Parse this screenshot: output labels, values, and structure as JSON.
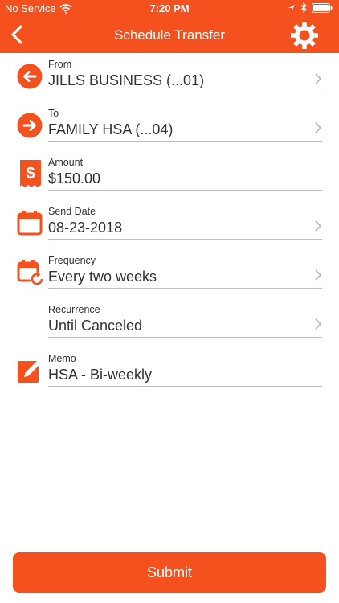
{
  "status_bar": {
    "carrier": "No Service",
    "time": "7:20 PM"
  },
  "header": {
    "title": "Schedule Transfer"
  },
  "form": {
    "from": {
      "label": "From",
      "value": "JILLS BUSINESS (...01)"
    },
    "to": {
      "label": "To",
      "value": "FAMILY HSA (...04)"
    },
    "amount": {
      "label": "Amount",
      "value": "$150.00"
    },
    "send_date": {
      "label": "Send Date",
      "value": "08-23-2018"
    },
    "frequency": {
      "label": "Frequency",
      "value": "Every two weeks"
    },
    "recurrence": {
      "label": "Recurrence",
      "value": "Until Canceled"
    },
    "memo": {
      "label": "Memo",
      "value": "HSA - Bi-weekly"
    }
  },
  "submit_label": "Submit",
  "colors": {
    "accent": "#f4511e",
    "divider": "#bdbdbd",
    "text": "#333333"
  }
}
